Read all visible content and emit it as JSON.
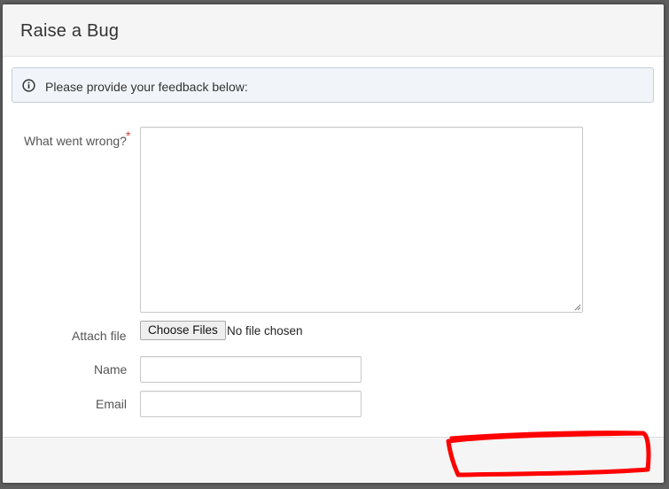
{
  "dialog": {
    "title": "Raise a Bug"
  },
  "info": {
    "icon": "info-icon",
    "message": "Please provide your feedback below:"
  },
  "form": {
    "what_went_wrong": {
      "label": "What went wrong?",
      "required_mark": "*",
      "value": ""
    },
    "attach_file": {
      "label": "Attach file",
      "button_label": "Choose Files",
      "status": "No file chosen"
    },
    "name": {
      "label": "Name",
      "value": ""
    },
    "email": {
      "label": "Email",
      "value": ""
    }
  },
  "annotation": {
    "color": "#ff0000",
    "shape": "freehand-rectangle"
  },
  "colors": {
    "required": "#d04437",
    "info_border": "#c5d0da",
    "info_background": "#f1f5f9"
  }
}
